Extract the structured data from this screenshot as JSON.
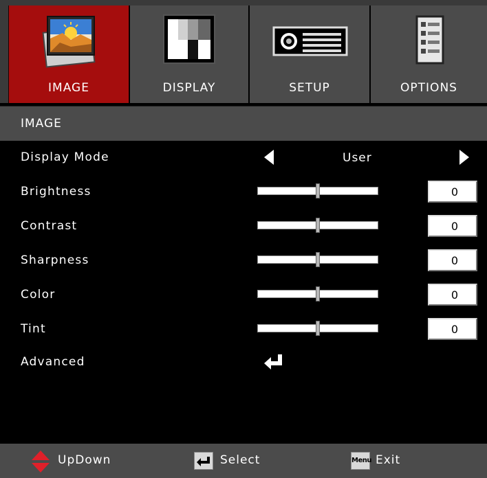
{
  "tabs": [
    {
      "label": "IMAGE",
      "icon": "image-icon",
      "active": true
    },
    {
      "label": "DISPLAY",
      "icon": "display-icon",
      "active": false
    },
    {
      "label": "SETUP",
      "icon": "projector-icon",
      "active": false
    },
    {
      "label": "OPTIONS",
      "icon": "checklist-icon",
      "active": false
    }
  ],
  "section_title": "IMAGE",
  "display_mode": {
    "label": "Display Mode",
    "value": "User"
  },
  "sliders": [
    {
      "label": "Brightness",
      "value": "0",
      "level": 0.5
    },
    {
      "label": "Contrast",
      "value": "0",
      "level": 0.5
    },
    {
      "label": "Sharpness",
      "value": "0",
      "level": 0.5
    },
    {
      "label": "Color",
      "value": "0",
      "level": 0.5
    },
    {
      "label": "Tint",
      "value": "0",
      "level": 0.5
    }
  ],
  "advanced": {
    "label": "Advanced"
  },
  "footer": {
    "updown": "UpDown",
    "select": "Select",
    "menu_key": "Menu",
    "exit": "Exit"
  },
  "colors": {
    "active_tab": "#a50d0d",
    "panel": "#4b4b4b",
    "background": "#000000",
    "updown_arrow": "#e0202a"
  }
}
